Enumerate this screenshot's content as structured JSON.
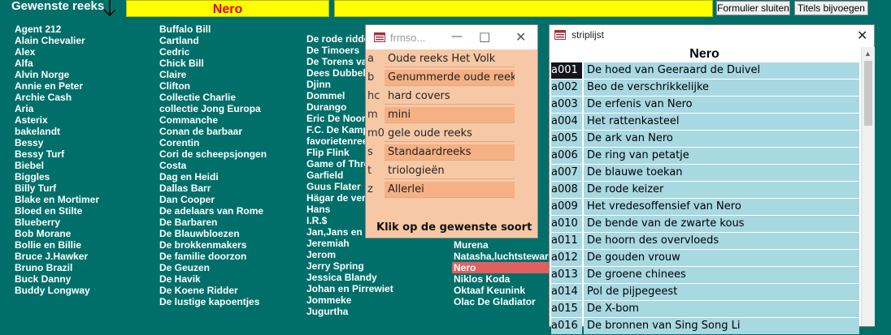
{
  "topbar": {
    "label": "Gewenste reeks",
    "selected_series": "Nero",
    "close_button": "Formulier sluiten",
    "titles_button": "Titels bijvoegen"
  },
  "series_columns": [
    [
      "Agent 212",
      "Alain Chevalier",
      "Alex",
      "Alfa",
      "Alvin Norge",
      "Annie en Peter",
      "Archie Cash",
      "Aria",
      "Asterix",
      "bakelandt",
      "Bessy",
      "Bessy Turf",
      "Biebel",
      "Biggles",
      "Billy Turf",
      "Blake en Mortimer",
      "Bloed en Stilte",
      "Blueberry",
      "Bob Morane",
      "Bollie en Billie",
      "Bruce J.Hawker",
      "Bruno Brazil",
      "Buck Danny",
      "Buddy Longway"
    ],
    [
      "Buffalo Bill",
      "Cartland",
      "Cedric",
      "Chick Bill",
      "Claire",
      "Clifton",
      "Collectie Charlie",
      "collectie Jong Europa",
      "Commanche",
      "Conan de barbaar",
      "Corentin",
      "Cori de scheepsjongen",
      "Costa",
      "Dag en Heidi",
      "Dallas Barr",
      "Dan Cooper",
      "De adelaars van Rome",
      "De Barbaren",
      "De Blauwbloezen",
      "De brokkenmakers",
      "De familie doorzon",
      "De Geuzen",
      "De Havik",
      "De Koene Ridder",
      "De lustige kapoentjes"
    ],
    [
      "De rode ridder",
      "De Timoers",
      "De Torens van",
      "Dees Dubbel",
      "Djinn",
      "Dommel",
      "Durango",
      "Eric De Noorman",
      "F.C. De Kampioenen",
      "favorietenreeks",
      "Flip Flink",
      "Game of Thrones",
      "Garfield",
      "Guus Flater",
      "Hägar de verschrikkelijke",
      "Hans",
      "I.R.$",
      "Jan,Jans en",
      "Jeremiah",
      "Jerom",
      "Jerry Spring",
      "Jessica Blandy",
      "Johan en Pirrewiet",
      "Jommeke",
      "Jugurtha"
    ],
    [
      "Murena",
      "Natasha,luchtstewardess",
      "Nero",
      "Niklos Koda",
      "Oktaaf Keunink",
      "Olac De Gladiator"
    ]
  ],
  "sort_window": {
    "title": "frmso...",
    "options": [
      {
        "code": "a",
        "label": "Oude reeks Het Volk"
      },
      {
        "code": "b",
        "label": "Genummerde oude reeks"
      },
      {
        "code": "hc",
        "label": "hard covers"
      },
      {
        "code": "m",
        "label": "mini"
      },
      {
        "code": "m0",
        "label": "gele  oude reeks"
      },
      {
        "code": "s",
        "label": "Standaardreeks"
      },
      {
        "code": "t",
        "label": "triologieën"
      },
      {
        "code": "z",
        "label": "Allerlei"
      }
    ],
    "instruction": "Klik op de gewenste soort"
  },
  "striplijst": {
    "title": "striplijst",
    "heading": "Nero",
    "rows": [
      {
        "code": "a001",
        "title": "De hoed van Geeraard de Duivel"
      },
      {
        "code": "a002",
        "title": "Beo de verschrikkelijke"
      },
      {
        "code": "a003",
        "title": "De erfenis van Nero"
      },
      {
        "code": "a004",
        "title": "Het rattenkasteel"
      },
      {
        "code": "a005",
        "title": "De ark van Nero"
      },
      {
        "code": "a006",
        "title": "De ring van petatje"
      },
      {
        "code": "a007",
        "title": "De blauwe toekan"
      },
      {
        "code": "a008",
        "title": "De rode keizer"
      },
      {
        "code": "a009",
        "title": "Het vredesoffensief van Nero"
      },
      {
        "code": "a010",
        "title": "De bende van de zwarte kous"
      },
      {
        "code": "a011",
        "title": "De hoorn des overvloeds"
      },
      {
        "code": "a012",
        "title": "De gouden vrouw"
      },
      {
        "code": "a013",
        "title": "De groene chinees"
      },
      {
        "code": "a014",
        "title": "Pol de pijpegeest"
      },
      {
        "code": "a015",
        "title": "De X-bom"
      },
      {
        "code": "a016",
        "title": "De bronnen van Sing Song Li"
      }
    ]
  },
  "colors": {
    "background": "#006f6a",
    "highlight": "#ffff00",
    "selected_text": "#e00000",
    "sort_window_bg": "#f7c8a6",
    "list_row_bg": "#a8d8e2"
  }
}
